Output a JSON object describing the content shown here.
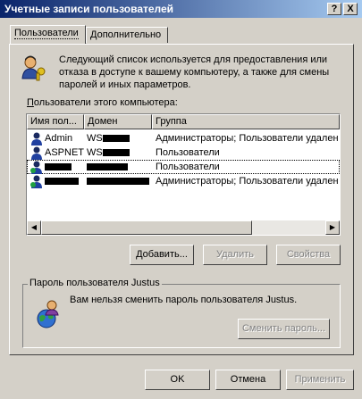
{
  "window": {
    "title": "Учетные записи пользователей",
    "help_label": "?",
    "close_label": "X"
  },
  "tabs": [
    {
      "label": "Пользователи"
    },
    {
      "label": "Дополнительно"
    }
  ],
  "description": "Следующий список используется для предоставления или отказа в доступе к вашему компьютеру, а также для смены паролей и иных параметров.",
  "users_label": {
    "prefix": "П",
    "rest": "ользователи этого компьютера:"
  },
  "columns": [
    "Имя пол...",
    "Домен",
    "Группа"
  ],
  "users": [
    {
      "name": "Admin",
      "domain": "WS",
      "group": "Администраторы; Пользователи удален"
    },
    {
      "name": "ASPNET",
      "domain": "WS",
      "group": "Пользователи"
    },
    {
      "name": "",
      "domain": "",
      "group": "Пользователи"
    },
    {
      "name": "",
      "domain": "",
      "group": "Администраторы; Пользователи удален"
    }
  ],
  "buttons": {
    "add": "Добавить...",
    "remove": "Удалить",
    "properties": "Свойства"
  },
  "password_group": {
    "title": "Пароль пользователя Justus",
    "message": "Вам нельзя сменить пароль пользователя Justus.",
    "change_button": "Сменить пароль..."
  },
  "footer": {
    "ok": "OK",
    "cancel": "Отмена",
    "apply": "Применить"
  }
}
